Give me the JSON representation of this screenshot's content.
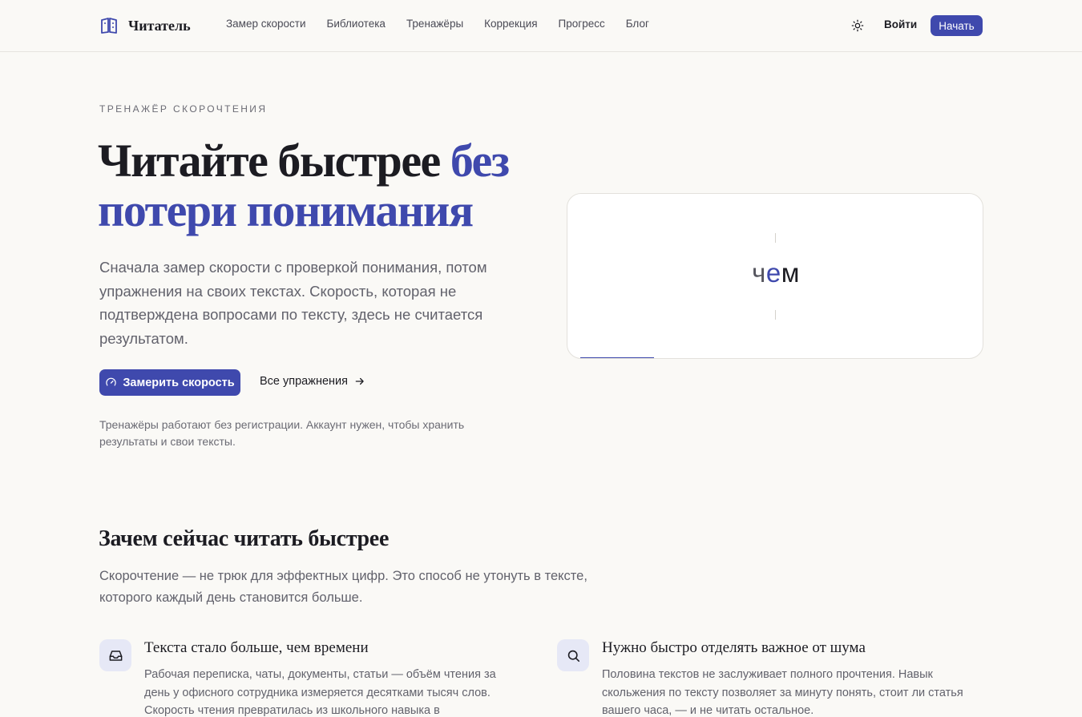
{
  "header": {
    "logo_text": "Читатель",
    "nav": [
      {
        "label": "Замер скорости"
      },
      {
        "label": "Библиотека"
      },
      {
        "label": "Тренажёры"
      },
      {
        "label": "Коррекция"
      },
      {
        "label": "Прогресс"
      },
      {
        "label": "Блог"
      }
    ],
    "theme_icon": "sun-icon",
    "login_label": "Войти",
    "start_label": "Начать"
  },
  "hero": {
    "eyebrow": "ТРЕНАЖЁР СКОРОЧТЕНИЯ",
    "title_plain": "Читайте быстрее ",
    "title_accent": "без потери понимания",
    "lead": "Сначала замер скорости с проверкой понимания, потом упражнения на своих текстах. Скорость, которая не подтверждена вопросами по тексту, здесь не считается результатом.",
    "cta_label": "Замерить скорость",
    "cta_icon": "gauge-icon",
    "all_exercises_label": "Все упражнения",
    "all_exercises_icon": "arrow-right-icon",
    "note": "Тренажёры работают без регистрации. Аккаунт нужен, чтобы хранить результаты и свои тексты."
  },
  "reader": {
    "word_pre": "ч",
    "word_orp": "е",
    "word_post": "м"
  },
  "why": {
    "title": "Зачем сейчас читать быстрее",
    "lead": "Скорочтение — не трюк для эффектных цифр. Это способ не утонуть в тексте, которого каждый день становится больше.",
    "features": [
      {
        "icon": "inbox-icon",
        "title": "Текста стало больше, чем времени",
        "text": "Рабочая переписка, чаты, документы, статьи — объём чтения за день у офисного сотрудника измеряется десятками тысяч слов. Скорость чтения превратилась из школьного навыка в"
      },
      {
        "icon": "search-icon",
        "title": "Нужно быстро отделять важное от шума",
        "text": "Половина текстов не заслуживает полного прочтения. Навык скольжения по тексту позволяет за минуту понять, стоит ли статья вашего часа, — и не читать остальное."
      }
    ]
  },
  "colors": {
    "accent": "#3f49ad",
    "background": "#faf9f6",
    "text": "#1c1c22",
    "muted": "#62626c"
  }
}
